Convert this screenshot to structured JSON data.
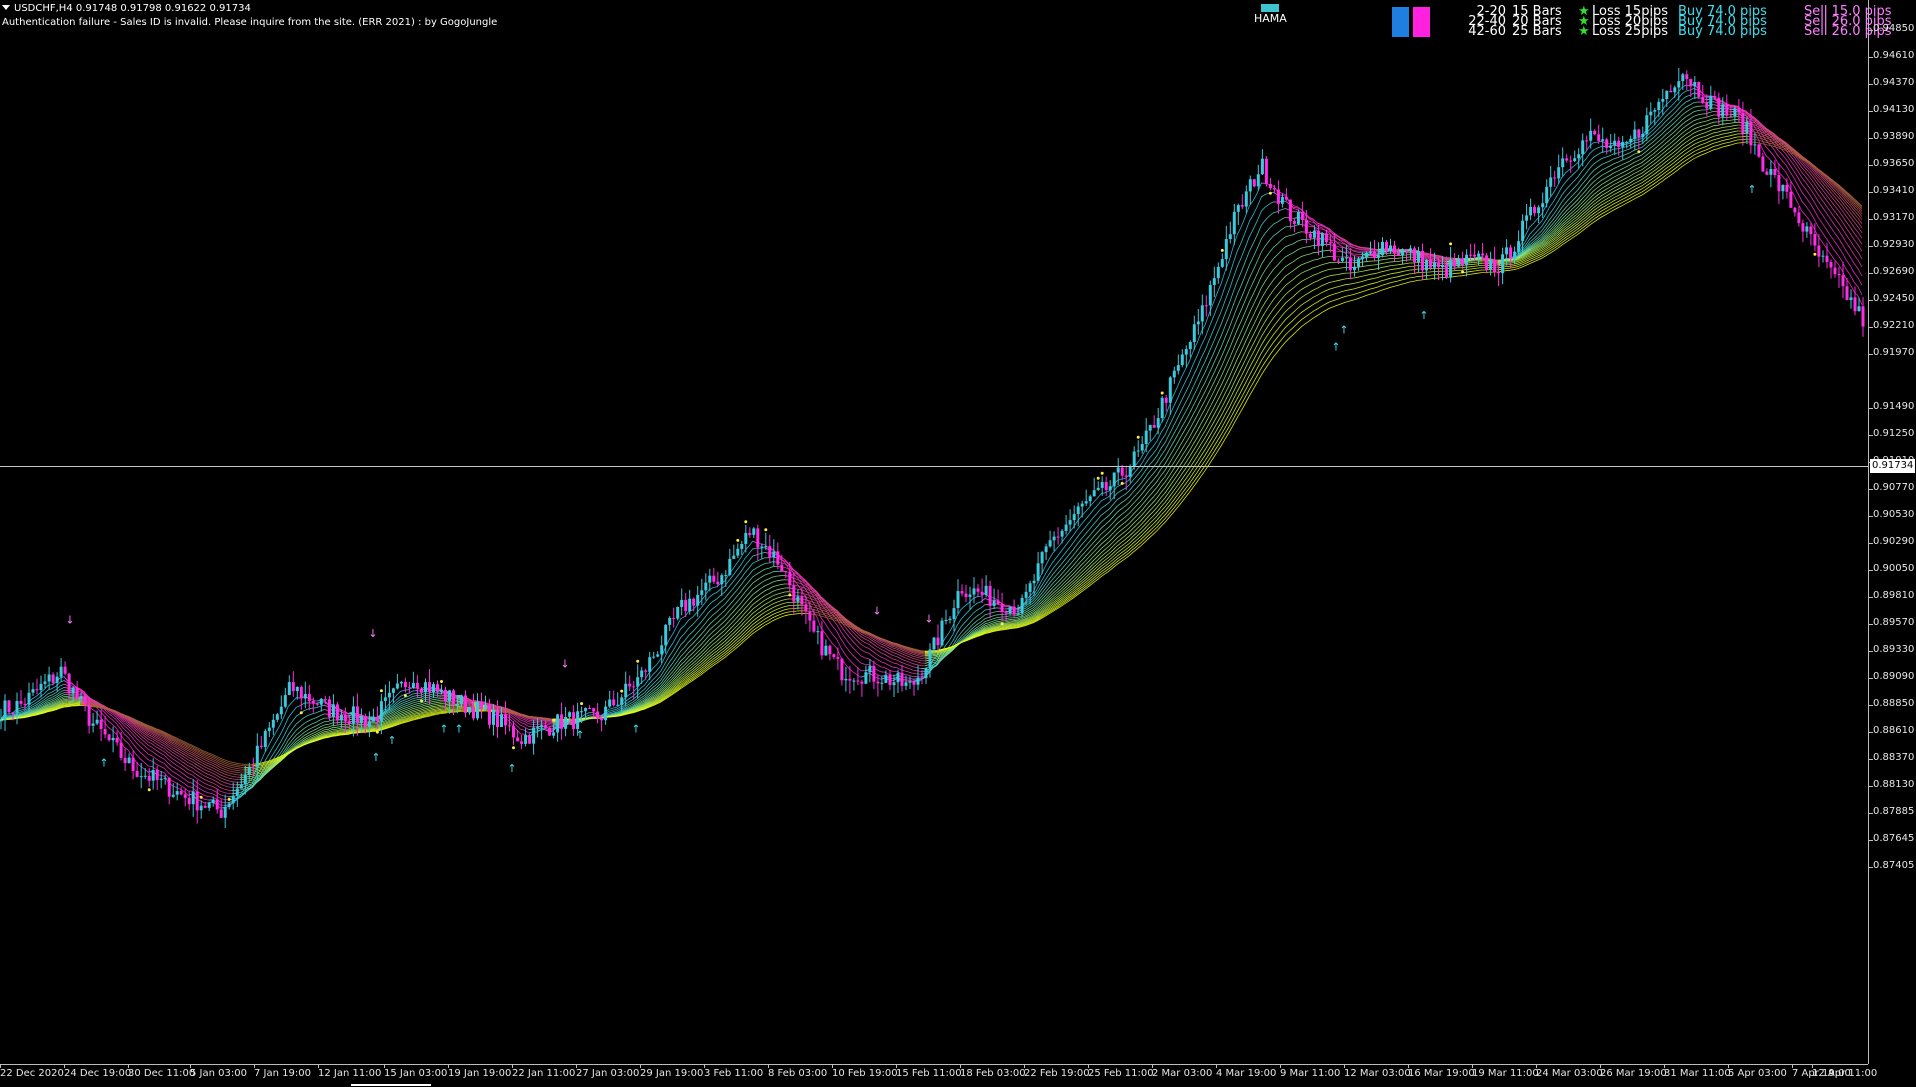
{
  "header": {
    "symbol_line": "USDCHF,H4  0.91748 0.91798 0.91622 0.91734",
    "auth_message": "Authentication failure - Sales ID is invalid. Please inquire from the site. (ERR 2021) : by GogoJungle"
  },
  "indicator": {
    "name": "HAMA",
    "color": "#3dc4d0"
  },
  "signal_panel": {
    "rows": [
      {
        "range": "2-20",
        "bars": "15 Bars",
        "loss": "Loss 15pips",
        "buy": "Buy 74.0 pips",
        "sell": "Sell 15.0 pips"
      },
      {
        "range": "22-40",
        "bars": "20 Bars",
        "loss": "Loss 20pips",
        "buy": "Buy 74.0 pips",
        "sell": "Sell 26.0 pips"
      },
      {
        "range": "42-60",
        "bars": "25 Bars",
        "loss": "Loss 25pips",
        "buy": "Buy 74.0 pips",
        "sell": "Sell 26.0 pips"
      }
    ],
    "star": "★"
  },
  "price_axis": {
    "ticks": [
      "0.94850",
      "0.94610",
      "0.94370",
      "0.94130",
      "0.93890",
      "0.93650",
      "0.93410",
      "0.93170",
      "0.92930",
      "0.92690",
      "0.92450",
      "0.92210",
      "0.91970",
      "0.91490",
      "0.91250",
      "0.91010",
      "0.90770",
      "0.90530",
      "0.90290",
      "0.90050",
      "0.89810",
      "0.89570",
      "0.89330",
      "0.89090",
      "0.88850",
      "0.88610",
      "0.88370",
      "0.88130",
      "0.87885",
      "0.87645",
      "0.87405"
    ],
    "current_price": "0.91734"
  },
  "time_axis": {
    "labels": [
      "22 Dec 2020",
      "24 Dec 19:00",
      "30 Dec 11:00",
      "5 Jan 03:00",
      "7 Jan 19:00",
      "12 Jan 11:00",
      "15 Jan 03:00",
      "19 Jan 19:00",
      "22 Jan 11:00",
      "27 Jan 03:00",
      "29 Jan 19:00",
      "3 Feb 11:00",
      "8 Feb 03:00",
      "10 Feb 19:00",
      "15 Feb 11:00",
      "18 Feb 03:00",
      "22 Feb 19:00",
      "25 Feb 11:00",
      "2 Mar 03:00",
      "4 Mar 19:00",
      "9 Mar 11:00",
      "12 Mar 03:00",
      "16 Mar 19:00",
      "19 Mar 11:00",
      "24 Mar 03:00",
      "26 Mar 19:00",
      "31 Mar 11:00",
      "5 Apr 03:00",
      "7 Apr 19:00",
      "12 Apr 11:00"
    ]
  },
  "chart_data": {
    "type": "candlestick",
    "symbol": "USDCHF",
    "timeframe": "H4",
    "ylim": [
      0.874,
      0.949
    ],
    "last": {
      "open": 0.91748,
      "high": 0.91798,
      "low": 0.91622,
      "close": 0.91734
    },
    "price_path": [
      [
        0,
        0.888
      ],
      [
        20,
        0.8885
      ],
      [
        60,
        0.8915
      ],
      [
        90,
        0.887
      ],
      [
        130,
        0.883
      ],
      [
        180,
        0.8805
      ],
      [
        220,
        0.879
      ],
      [
        250,
        0.883
      ],
      [
        290,
        0.89
      ],
      [
        330,
        0.888
      ],
      [
        370,
        0.887
      ],
      [
        410,
        0.891
      ],
      [
        450,
        0.889
      ],
      [
        490,
        0.8875
      ],
      [
        520,
        0.8855
      ],
      [
        560,
        0.887
      ],
      [
        600,
        0.8875
      ],
      [
        640,
        0.891
      ],
      [
        680,
        0.897
      ],
      [
        720,
        0.9
      ],
      [
        750,
        0.904
      ],
      [
        780,
        0.901
      ],
      [
        810,
        0.895
      ],
      [
        840,
        0.8915
      ],
      [
        880,
        0.891
      ],
      [
        910,
        0.89
      ],
      [
        930,
        0.893
      ],
      [
        960,
        0.899
      ],
      [
        990,
        0.898
      ],
      [
        1020,
        0.897
      ],
      [
        1050,
        0.903
      ],
      [
        1080,
        0.906
      ],
      [
        1110,
        0.908
      ],
      [
        1140,
        0.911
      ],
      [
        1170,
        0.917
      ],
      [
        1200,
        0.923
      ],
      [
        1230,
        0.931
      ],
      [
        1260,
        0.9365
      ],
      [
        1290,
        0.932
      ],
      [
        1320,
        0.93
      ],
      [
        1350,
        0.927
      ],
      [
        1380,
        0.9295
      ],
      [
        1410,
        0.9285
      ],
      [
        1440,
        0.927
      ],
      [
        1470,
        0.928
      ],
      [
        1500,
        0.9275
      ],
      [
        1530,
        0.932
      ],
      [
        1560,
        0.937
      ],
      [
        1590,
        0.939
      ],
      [
        1620,
        0.9375
      ],
      [
        1650,
        0.941
      ],
      [
        1680,
        0.945
      ],
      [
        1710,
        0.942
      ],
      [
        1740,
        0.9405
      ],
      [
        1760,
        0.937
      ],
      [
        1790,
        0.933
      ],
      [
        1820,
        0.928
      ],
      [
        1845,
        0.925
      ],
      [
        1866,
        0.9222
      ]
    ]
  }
}
